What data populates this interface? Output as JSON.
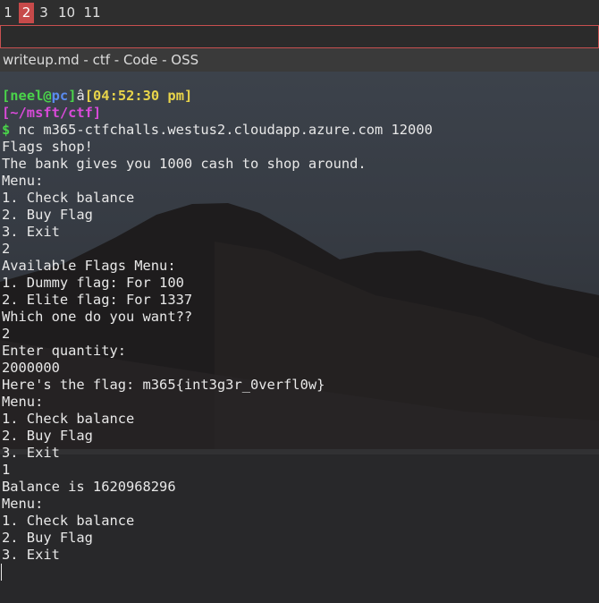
{
  "workspaces": [
    "1",
    "2",
    "3",
    "10",
    "11"
  ],
  "active_workspace": "2",
  "window": {
    "title": "writeup.md - ctf - Code - OSS"
  },
  "prompt": {
    "open_bracket": "[",
    "user": "neel",
    "at": "@",
    "host": "pc",
    "close_bracket": "]",
    "separator": "â",
    "time_open": "[",
    "time": "04:52:30 pm",
    "time_close": "]",
    "path_line": "[~/msft/ctf]",
    "dollar": "$",
    "command": " nc m365-ctfchalls.westus2.cloudapp.azure.com 12000"
  },
  "output": [
    "Flags shop!",
    "The bank gives you 1000 cash to shop around.",
    "Menu:",
    "1. Check balance",
    "2. Buy Flag",
    "3. Exit",
    "2",
    "Available Flags Menu:",
    "1. Dummy flag: For 100",
    "2. Elite flag: For 1337",
    "Which one do you want??",
    "2",
    "Enter quantity:",
    "2000000",
    "Here's the flag: m365{int3g3r_0verfl0w}",
    "Menu:",
    "1. Check balance",
    "2. Buy Flag",
    "3. Exit",
    "1",
    "Balance is 1620968296",
    "Menu:",
    "1. Check balance",
    "2. Buy Flag",
    "3. Exit"
  ],
  "colors": {
    "workspace_active": "#c74a4a",
    "strip_border": "#c85050",
    "prompt_user": "#4ad44a",
    "prompt_time": "#e8d44a",
    "prompt_path": "#d84ad8",
    "prompt_host": "#5a8cf0"
  }
}
